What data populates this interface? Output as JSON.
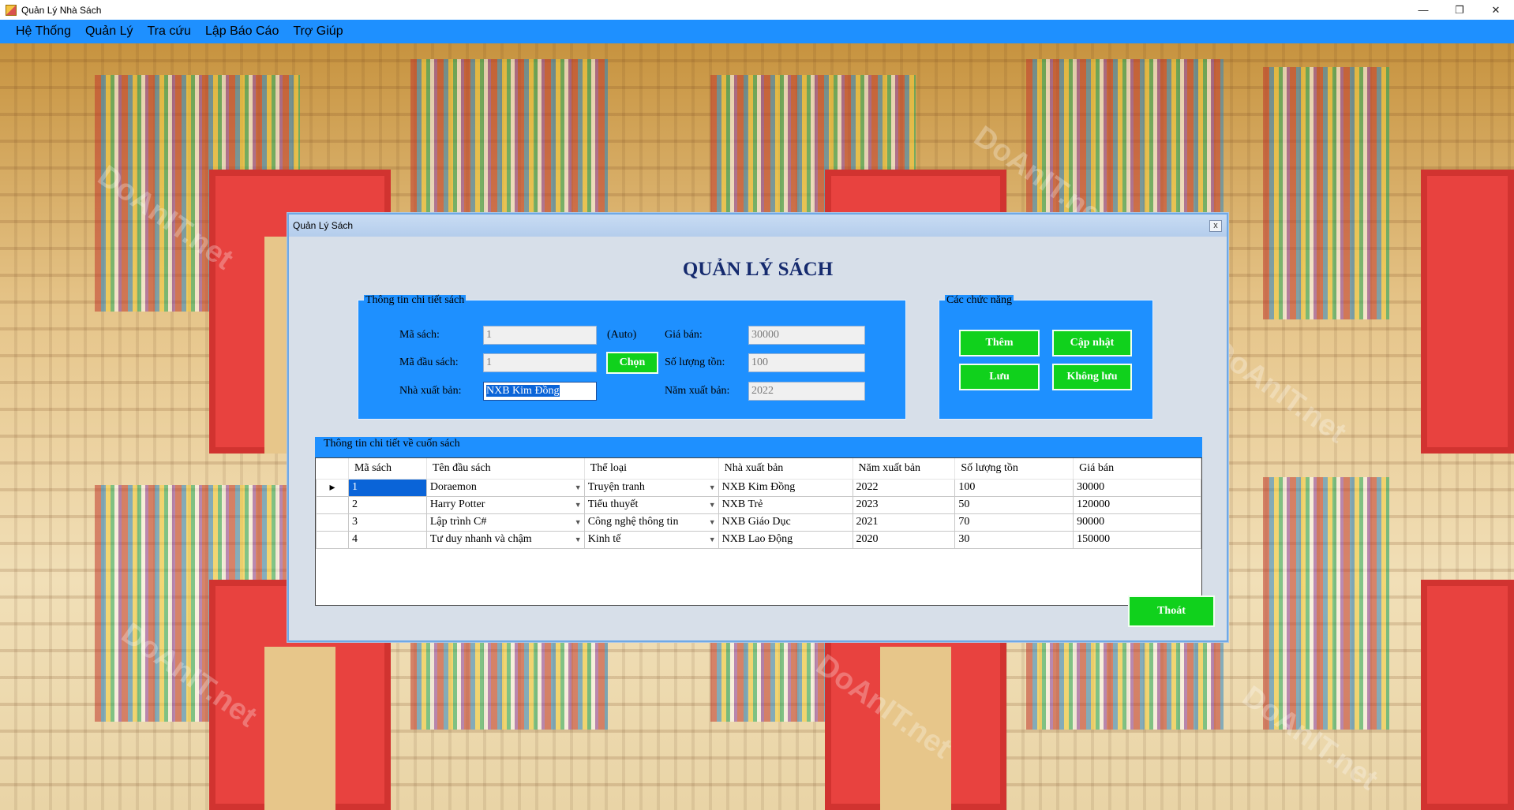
{
  "window": {
    "title": "Quản Lý Nhà Sách",
    "controls": [
      "—",
      "❐",
      "✕"
    ]
  },
  "menu": [
    "Hệ Thống",
    "Quản Lý",
    "Tra cứu",
    "Lập Báo Cáo",
    "Trợ Giúp"
  ],
  "dialog": {
    "title": "Quản Lý Sách",
    "close": "x",
    "heading": "QUẢN LÝ SÁCH",
    "details": {
      "legend": "Thông tin chi tiết sách",
      "ma_sach_label": "Mã sách:",
      "ma_sach_value": "1",
      "auto_label": "(Auto)",
      "ma_dau_sach_label": "Mã đầu sách:",
      "ma_dau_sach_value": "1",
      "chon_button": "Chọn",
      "nxb_label": "Nhà xuất bản:",
      "nxb_value": "NXB Kim Đồng",
      "gia_ban_label": "Giá bán:",
      "gia_ban_value": "30000",
      "so_luong_label": "Số lượng tồn:",
      "so_luong_value": "100",
      "nam_xb_label": "Năm xuất bản:",
      "nam_xb_value": "2022"
    },
    "functions": {
      "legend": "Các chức năng",
      "them": "Thêm",
      "cap_nhat": "Cập nhật",
      "luu": "Lưu",
      "khong_luu": "Không lưu"
    },
    "grid": {
      "legend": "Thông tin chi tiết về cuốn sách",
      "columns": [
        "Mã sách",
        "Tên đầu sách",
        "Thể loại",
        "Nhà xuất bản",
        "Năm xuất bản",
        "Số lượng tồn",
        "Giá bán"
      ],
      "rows": [
        [
          "1",
          "Doraemon",
          "Truyện tranh",
          "NXB Kim Đồng",
          "2022",
          "100",
          "30000"
        ],
        [
          "2",
          "Harry Potter",
          "Tiểu thuyết",
          "NXB Trẻ",
          "2023",
          "50",
          "120000"
        ],
        [
          "3",
          "Lập trình C#",
          "Công nghệ thông tin",
          "NXB Giáo Dục",
          "2021",
          "70",
          "90000"
        ],
        [
          "4",
          "Tư duy nhanh và chậm",
          "Kinh tế",
          "NXB Lao Động",
          "2020",
          "30",
          "150000"
        ]
      ],
      "current_row_marker": "▸"
    },
    "thoat": "Thoát"
  },
  "watermark": "DoAnIT.net",
  "colors": {
    "accent": "#1e90ff",
    "button": "#10d11c",
    "heading": "#152a6e"
  }
}
